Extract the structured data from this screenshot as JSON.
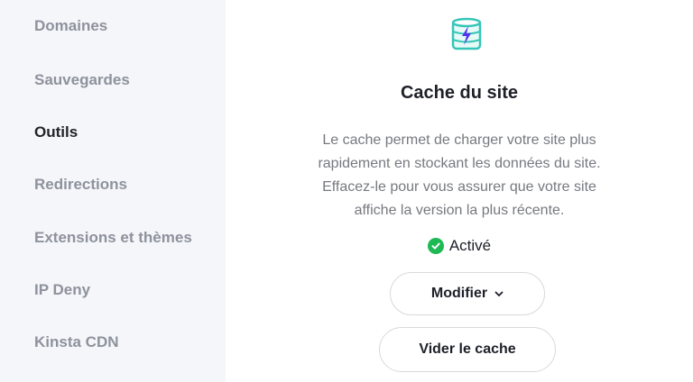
{
  "sidebar": {
    "items": [
      {
        "label": "Domaines",
        "active": false
      },
      {
        "label": "Sauvegardes",
        "active": false
      },
      {
        "label": "Outils",
        "active": true
      },
      {
        "label": "Redirections",
        "active": false
      },
      {
        "label": "Extensions et thèmes",
        "active": false
      },
      {
        "label": "IP Deny",
        "active": false
      },
      {
        "label": "Kinsta CDN",
        "active": false
      }
    ]
  },
  "main": {
    "icon": "database-bolt-icon",
    "title": "Cache du site",
    "description_lines": [
      "Le cache permet de charger votre site plus",
      "rapidement en stockant les données du site.",
      "Effacez-le pour vous assurer que votre site",
      "affiche la version la plus récente."
    ],
    "status": {
      "label": "Activé",
      "icon": "check-circle-icon",
      "color": "#1db954"
    },
    "buttons": {
      "modify": "Modifier",
      "clear": "Vider le cache"
    }
  },
  "colors": {
    "sidebar_bg": "#f5f6fa",
    "nav_inactive": "#8d929c",
    "nav_active": "#212329",
    "accent_purple": "#5333ed",
    "accent_teal": "#36c5b8"
  }
}
